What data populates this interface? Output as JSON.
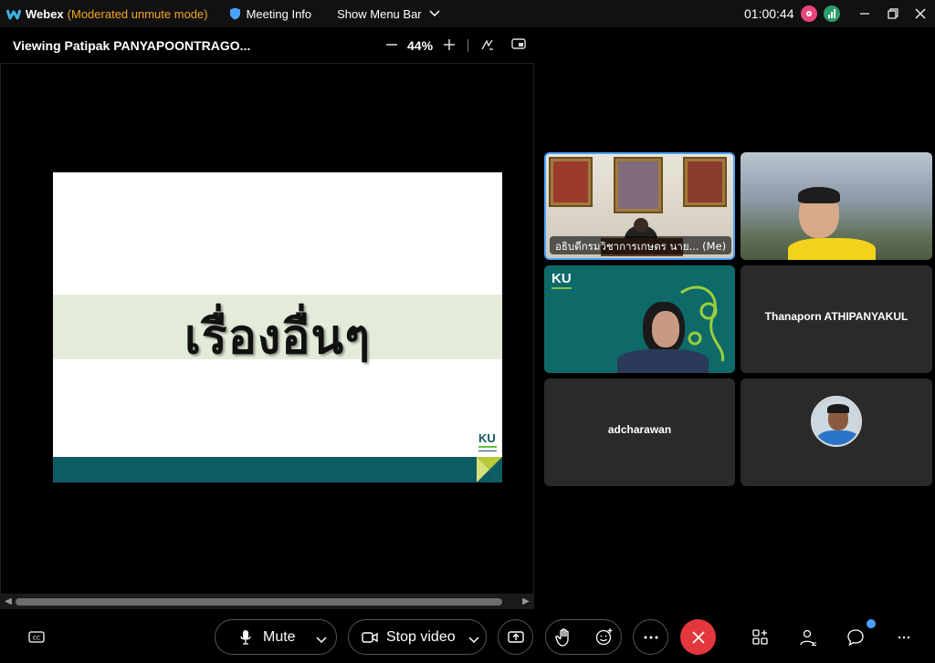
{
  "titlebar": {
    "app_name": "Webex",
    "mode": "(Moderated unmute mode)",
    "meeting_info": "Meeting Info",
    "show_menu_bar": "Show Menu Bar",
    "timer": "01:00:44"
  },
  "share": {
    "title": "Viewing Patipak PANYAPOONTRAGO...",
    "zoom": "44%",
    "slide_text": "เรื่องอื่นๆ",
    "slide_logo": "KU"
  },
  "participants": [
    {
      "name": "อธิบดีกรมวิชาการเกษตร นาย... (Me)",
      "video": true
    },
    {
      "name": "",
      "video": true
    },
    {
      "name": "",
      "video": true
    },
    {
      "name": "Thanaporn ATHIPANYAKUL",
      "video": false
    },
    {
      "name": "adcharawan",
      "video": false
    },
    {
      "name": "",
      "video": false,
      "avatar": true
    }
  ],
  "tile3_logo": "KU",
  "toolbar": {
    "mute_label": "Mute",
    "stop_video_label": "Stop video"
  },
  "colors": {
    "accent": "#4aa3ff",
    "end_call": "#e5373e",
    "mode_text": "#f5a623",
    "slide_teal": "#0d5c63"
  }
}
